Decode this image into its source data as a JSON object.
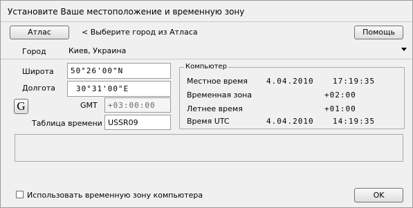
{
  "window": {
    "title": "Установите Ваше местоположение и временную зону"
  },
  "toolbar": {
    "atlas_label": "Атлас",
    "hint": "< Выберите город из Атласа",
    "help_label": "Помощь"
  },
  "city": {
    "label": "Город",
    "value": "Киев, Украина"
  },
  "coords": {
    "lat_label": "Широта",
    "lat_value": "50°26'00\"N",
    "lon_label": "Долгота",
    "lon_value": "30°31'00\"E",
    "g_label": "G",
    "gmt_label": "GMT",
    "gmt_value": "+03:00:00",
    "tz_table_label": "Таблица времени",
    "tz_table_value": "USSR09"
  },
  "computer": {
    "title": "Компьютер",
    "local_label": "Местное время",
    "local_date": "4.04.2010",
    "local_time": "17:19:35",
    "tz_label": "Временная зона",
    "tz_value": "+02:00",
    "dst_label": "Летнее время",
    "dst_value": "+01:00",
    "utc_label": "Время UTC",
    "utc_date": "4.04.2010",
    "utc_time": "14:19:35"
  },
  "footer": {
    "use_pc_tz_label": "Использовать временную зону компьютера",
    "use_pc_tz_checked": false,
    "ok_label": "OK"
  },
  "icons": {
    "dropdown": "chevron-down-icon"
  }
}
